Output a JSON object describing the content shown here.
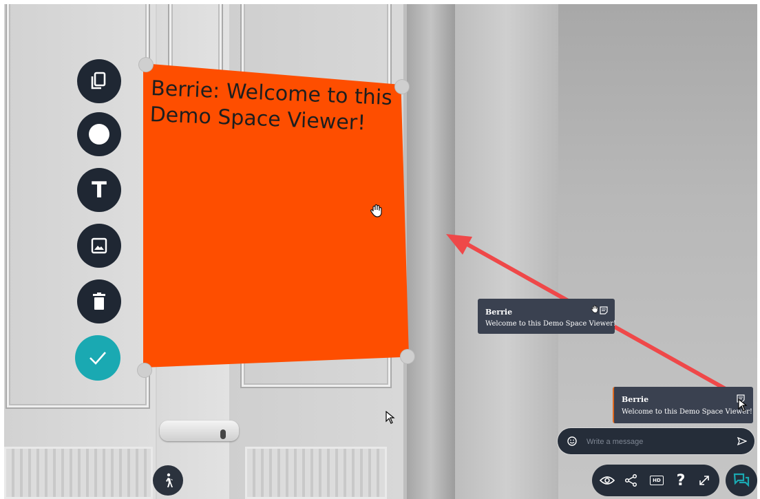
{
  "colors": {
    "note": "#fe4e00",
    "toolbar": "#1f2733",
    "accent": "#1aa9b2",
    "chat_bubble": "#3a4150",
    "arrow": "#ef4849"
  },
  "toolbar": {
    "items": [
      {
        "name": "copy-button",
        "icon": "copy-icon"
      },
      {
        "name": "color-button",
        "icon": "circle-icon"
      },
      {
        "name": "text-button",
        "icon": "text-icon",
        "glyph": "T"
      },
      {
        "name": "image-button",
        "icon": "image-icon"
      },
      {
        "name": "delete-button",
        "icon": "trash-icon"
      },
      {
        "name": "confirm-button",
        "icon": "check-icon"
      }
    ]
  },
  "note": {
    "text": "Berrie: Welcome to this\nDemo Space Viewer!"
  },
  "chat_preview": {
    "name": "Berrie",
    "message": "Welcome to this Demo Space Viewer!"
  },
  "chat_latest": {
    "name": "Berrie",
    "message": "Welcome to this Demo Space Viewer!"
  },
  "message_input": {
    "placeholder": "Write a message",
    "value": ""
  },
  "bottom_bar": {
    "items": [
      "eye-icon",
      "share-icon",
      "hd-icon",
      "help-icon",
      "fullscreen-icon"
    ],
    "help_glyph": "?",
    "hd_label": "HD"
  }
}
